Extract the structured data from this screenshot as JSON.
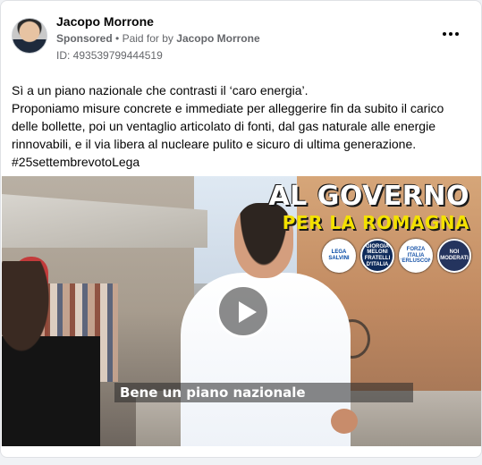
{
  "post": {
    "author": "Jacopo Morrone",
    "sponsored_label": "Sponsored",
    "separator": "•",
    "paid_for_prefix": "Paid for by",
    "paid_for_name": "Jacopo Morrone",
    "id_line": "ID: 493539799444519",
    "more_icon": "ellipsis-horizontal-icon"
  },
  "body": {
    "line1": "Sì a un piano nazionale che contrasti il ‘caro energia’.",
    "paragraph": "Proponiamo misure concrete e immediate per alleggerire fin da subito il carico delle bollette, poi un ventaglio articolato di fonti, dal gas naturale alle energie rinnovabili, e il via libera al nucleare pulito e sicuro di ultima generazione.",
    "hashtag": "#25settembrevotoLega"
  },
  "video": {
    "overlay_line1": "AL GOVERNO",
    "overlay_line2": "PER LA ROMAGNA",
    "caption": "Bene un piano nazionale",
    "play_icon": "play-icon",
    "logos": [
      {
        "name": "lega-logo",
        "text": "LEGA SALVINI"
      },
      {
        "name": "fratelli-ditalia-logo",
        "text": "GIORGIA MELONI FRATELLI D'ITALIA"
      },
      {
        "name": "forza-italia-logo",
        "text": "FORZA ITALIA BERLUSCONI"
      },
      {
        "name": "noi-moderati-logo",
        "text": "NOI MODERATI"
      }
    ],
    "colors": {
      "overlay_primary": "#ffffff",
      "overlay_secondary": "#f3e100"
    }
  }
}
